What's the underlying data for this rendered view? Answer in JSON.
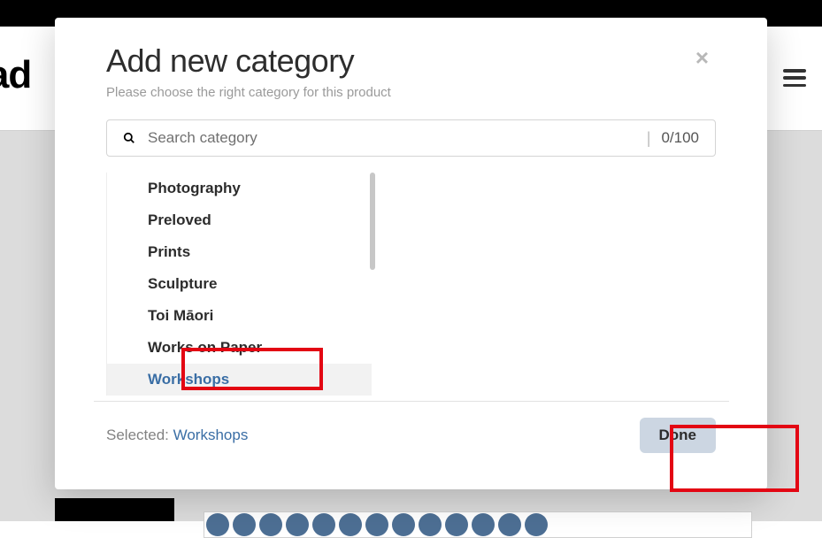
{
  "brand": {
    "logo_text": "rtrad"
  },
  "modal": {
    "title": "Add new category",
    "subtitle": "Please choose the right category for this product",
    "close_label": "×"
  },
  "search": {
    "placeholder": "Search category",
    "value": "",
    "counter": "0/100"
  },
  "categories": {
    "items": [
      {
        "label": "Photography"
      },
      {
        "label": "Preloved"
      },
      {
        "label": "Prints"
      },
      {
        "label": "Sculpture"
      },
      {
        "label": "Toi Māori"
      },
      {
        "label": "Works on Paper"
      },
      {
        "label": "Workshops"
      }
    ],
    "selected_index": 6
  },
  "footer": {
    "selected_prefix": "Selected: ",
    "selected_value": "Workshops",
    "done_label": "Done"
  }
}
